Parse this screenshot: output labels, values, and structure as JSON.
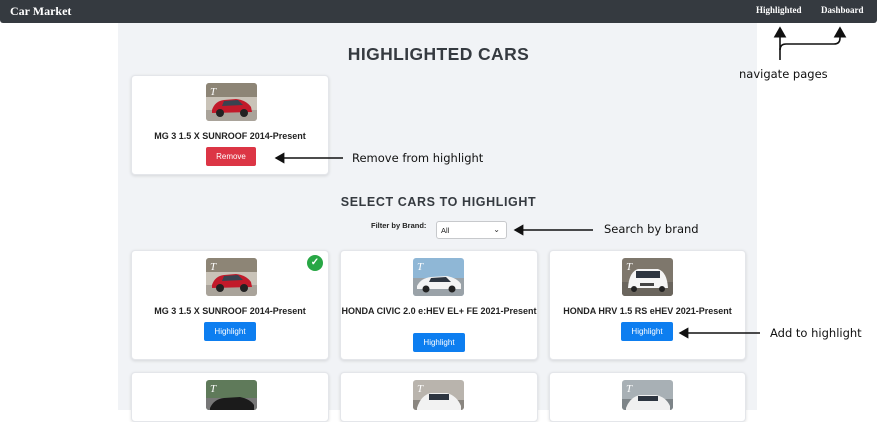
{
  "navbar": {
    "brand": "Car Market",
    "links": [
      "Highlighted",
      "Dashboard"
    ]
  },
  "highlighted_section": {
    "title": "HIGHLIGHTED CARS",
    "cars": [
      {
        "title": "MG 3 1.5 X SUNROOF 2014-Present",
        "action_label": "Remove"
      }
    ]
  },
  "select_section": {
    "title": "SELECT CARS TO HIGHLIGHT",
    "filter_label": "Filter by Brand:",
    "filter_value": "All",
    "cars": [
      {
        "title": "MG 3 1.5 X SUNROOF 2014-Present",
        "action_label": "Highlight",
        "selected": true
      },
      {
        "title": "HONDA CIVIC 2.0 e:HEV EL+ FE 2021-Present",
        "action_label": "Highlight",
        "selected": false
      },
      {
        "title": "HONDA HRV 1.5 RS eHEV 2021-Present",
        "action_label": "Highlight",
        "selected": false
      }
    ]
  },
  "annotations": {
    "navigate": "navigate pages",
    "remove": "Remove from highlight",
    "search": "Search by brand",
    "add": "Add to highlight"
  },
  "colors": {
    "navbar": "#353a40",
    "remove": "#dc3545",
    "highlight": "#0d7ef0",
    "selected_check": "#28a745"
  },
  "icons": {
    "selected": "check-circle-icon",
    "filter_dropdown": "chevron-down-icon"
  }
}
